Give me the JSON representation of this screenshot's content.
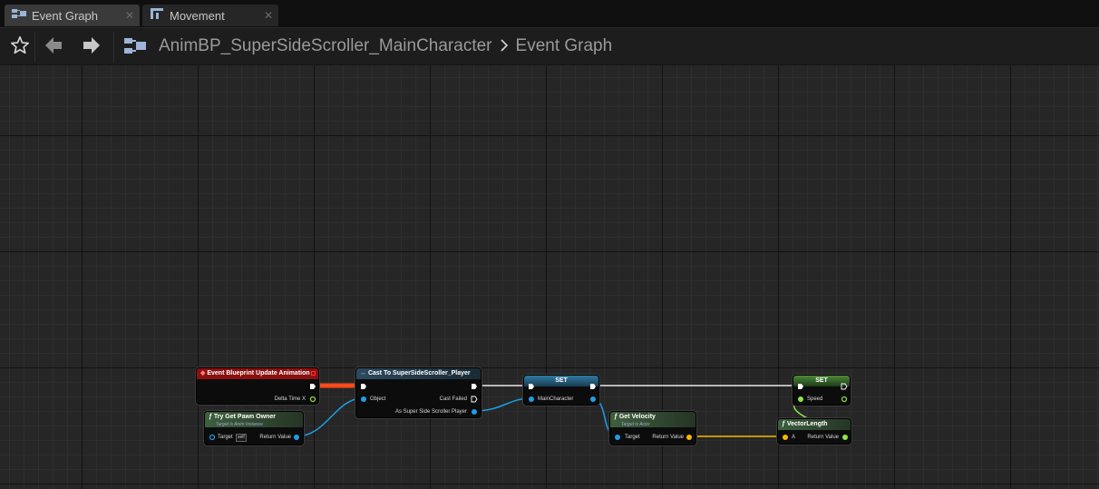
{
  "tabs": [
    {
      "label": "Event Graph",
      "icon": "event-graph-icon",
      "active": true
    },
    {
      "label": "Movement",
      "icon": "function-graph-icon",
      "active": false
    }
  ],
  "toolbar": {
    "breadcrumb_asset": "AnimBP_SuperSideScroller_MainCharacter",
    "breadcrumb_graph": "Event Graph",
    "icons": [
      "star-icon",
      "back-arrow-icon",
      "forward-arrow-icon",
      "blueprint-icon"
    ]
  },
  "graph": {
    "nodes": {
      "event_update": {
        "title": "Event Blueprint Update Animation",
        "pins": {
          "delta": "Delta Time X"
        },
        "color": "#8b1010"
      },
      "try_get_pawn": {
        "title": "Try Get Pawn Owner",
        "subtitle": "Target is Anim Instance",
        "pins": {
          "target": "Target",
          "self": "self",
          "ret": "Return Value"
        },
        "color": "#3a5a3a"
      },
      "cast": {
        "title": "Cast To SuperSideScroller_Player",
        "pins": {
          "object": "Object",
          "failed": "Cast Failed",
          "as": "As Super Side Scroller Player"
        },
        "color": "#2c4a5e"
      },
      "set_main": {
        "title": "SET",
        "pins": {
          "main": "MainCharacter"
        },
        "color": "#2a6a8a"
      },
      "get_velocity": {
        "title": "Get Velocity",
        "subtitle": "Target is Actor",
        "pins": {
          "target": "Target",
          "ret": "Return Value"
        },
        "color": "#3a5a3a"
      },
      "set_speed": {
        "title": "SET",
        "pins": {
          "speed": "Speed"
        },
        "color": "#4a7a3a"
      },
      "vector_length": {
        "title": "VectorLength",
        "pins": {
          "a": "A",
          "ret": "Return Value"
        },
        "color": "#3a5a3a"
      }
    },
    "colors": {
      "exec": "#ffffff",
      "object": "#1e9ee6",
      "vector": "#f5b800",
      "float": "#8ee64a",
      "event_header": "#8b1010"
    }
  }
}
